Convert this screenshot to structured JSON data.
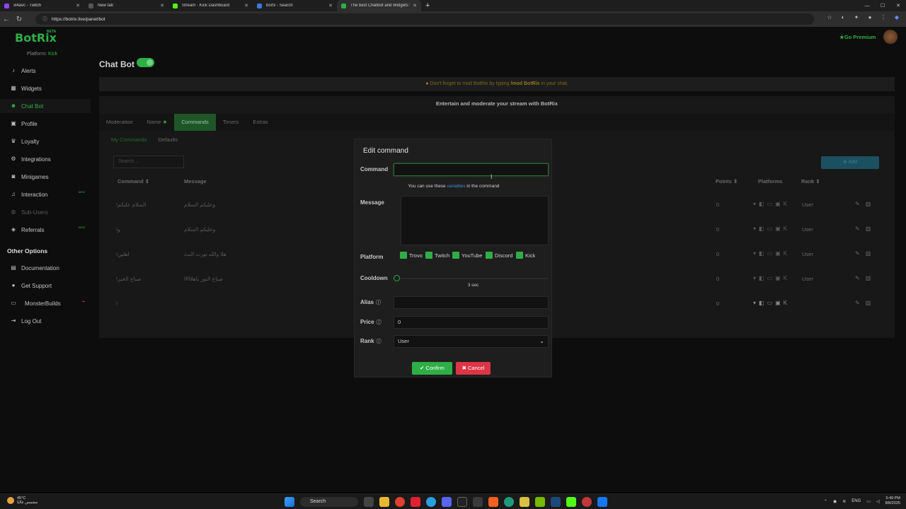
{
  "browser": {
    "tabs": [
      {
        "title": "xl4avc - Twitch",
        "color": "#9146ff"
      },
      {
        "title": "New tab",
        "color": "#888888"
      },
      {
        "title": "Stream - Kick Dashboard",
        "color": "#53fc18"
      },
      {
        "title": "bortx - Search",
        "color": "#3a7bd5"
      },
      {
        "title": "The best ChatBot and Widgets fo",
        "color": "#2fae46"
      }
    ],
    "new_tab": "+",
    "url": "https://botrix.live/panel/bot"
  },
  "sidebar": {
    "logo": "BotRix",
    "beta": "BETA",
    "platform_label": "Platform:",
    "platform_value": "Kick",
    "items": [
      {
        "label": "Alerts",
        "icon": "bell-icon",
        "glyph": "♪"
      },
      {
        "label": "Widgets",
        "icon": "widgets-icon",
        "glyph": "▦"
      },
      {
        "label": "Chat Bot",
        "icon": "chatbot-icon",
        "glyph": "☻"
      },
      {
        "label": "Profile",
        "icon": "profile-icon",
        "glyph": "▣"
      },
      {
        "label": "Loyalty",
        "icon": "trophy-icon",
        "glyph": "♛"
      },
      {
        "label": "Integrations",
        "icon": "integrations-icon",
        "glyph": "⚙"
      },
      {
        "label": "Minigames",
        "icon": "gamepad-icon",
        "glyph": "◙"
      },
      {
        "label": "Interaction",
        "icon": "music-icon",
        "glyph": "♫"
      },
      {
        "label": "Sub-Users",
        "icon": "users-icon",
        "glyph": "◍"
      },
      {
        "label": "Referrals",
        "icon": "referrals-icon",
        "glyph": "◈"
      }
    ],
    "new_badge": "NEW",
    "other_options": "Other Options",
    "other_items": [
      {
        "label": "Documentation",
        "icon": "document-icon",
        "glyph": "▤"
      },
      {
        "label": "Get Support",
        "icon": "support-icon",
        "glyph": "●"
      },
      {
        "label": "MonsterBuilds",
        "icon": "monster-icon",
        "glyph": "▭"
      },
      {
        "label": "Log Out",
        "icon": "logout-icon",
        "glyph": "⇥"
      }
    ]
  },
  "header": {
    "premium": "Go Premium"
  },
  "main": {
    "title": "Chat Bot",
    "notice_pre": "Don't forget to mod BotRix by typing ",
    "notice_cmd": "/mod BotRix",
    "notice_post": " in your chat.",
    "subtitle": "Entertain and moderate your stream with BotRix",
    "tabs": [
      "Moderation",
      "Name",
      "Commands",
      "Timers",
      "Extras"
    ],
    "subtabs": [
      "My Commands",
      "Defaults"
    ],
    "search_placeholder": "Search...",
    "add_label": "Add",
    "columns": {
      "command": "Command",
      "message": "Message",
      "points": "Points",
      "platforms": "Platforms",
      "rank": "Rank"
    },
    "rows": [
      {
        "command": "!السلام عليكم",
        "message": "وعليكم السلام",
        "points": "0",
        "rank": "User"
      },
      {
        "command": "!و",
        "message": "وعليكم السلام",
        "points": "0",
        "rank": "User"
      },
      {
        "command": "!اهلين",
        "message": "هلا والله نورت البث",
        "points": "0",
        "rank": "User"
      },
      {
        "command": "!صباح الخير",
        "message": "صباح النور ياهلااااا",
        "points": "0",
        "rank": "User"
      },
      {
        "command": "!",
        "message": "",
        "points": "0",
        "rank": ""
      }
    ]
  },
  "modal": {
    "title": "Edit command",
    "command_label": "Command",
    "command_value": "",
    "hint_pre": "You can use these ",
    "hint_link": "variables",
    "hint_post": " in the command",
    "message_label": "Message",
    "platform_label": "Platform",
    "platforms": [
      "Trovo",
      "Twitch",
      "YouTube",
      "Discord",
      "Kick"
    ],
    "cooldown_label": "Cooldown",
    "cooldown_value": "3 sec",
    "alias_label": "Alias",
    "price_label": "Price",
    "price_value": "0",
    "rank_label": "Rank",
    "rank_value": "User",
    "confirm": "Confirm",
    "cancel": "Cancel",
    "confirm_color": "#2fae46",
    "cancel_color": "#dc3545"
  },
  "taskbar": {
    "temp": "45°C",
    "weather_text": "مشمس غالبًا",
    "search": "Search",
    "lang": "ENG",
    "time": "5:49 PM",
    "date": "8/8/2025"
  }
}
